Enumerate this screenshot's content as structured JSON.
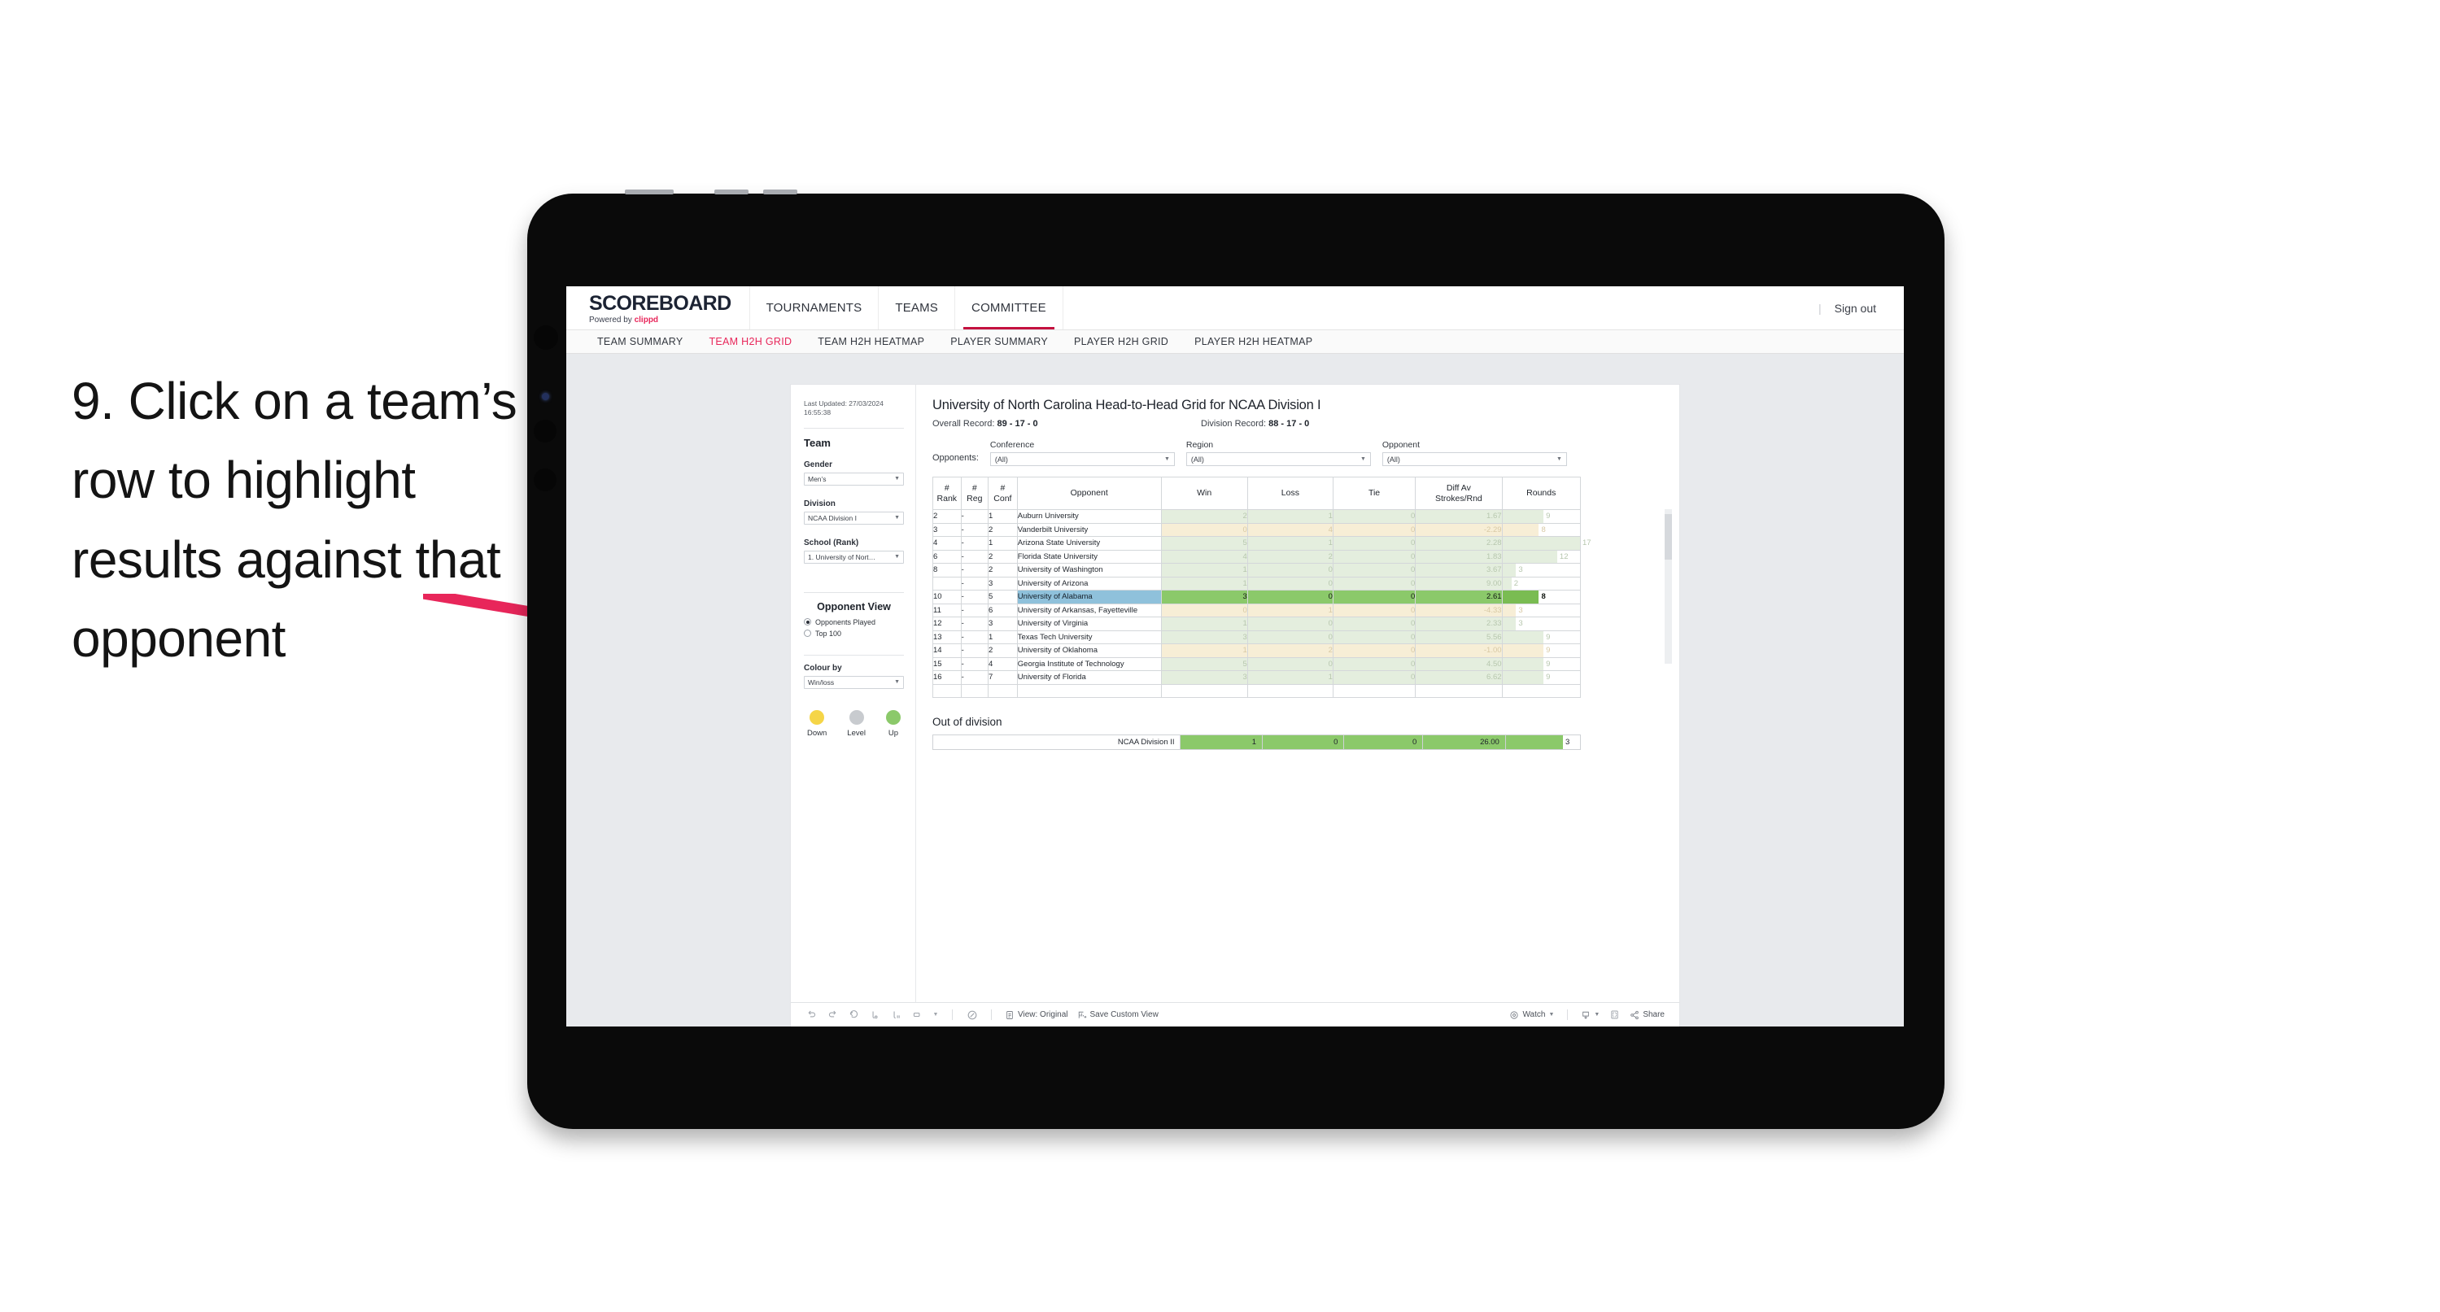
{
  "annotation": {
    "text": "9. Click on a team’s row to highlight results against that opponent",
    "arrow_color": "#E8265A"
  },
  "header": {
    "logo_main": "SCOREBOARD",
    "logo_sub_prefix": "Powered by ",
    "logo_brand": "clippd",
    "nav": [
      {
        "label": "TOURNAMENTS",
        "active": false
      },
      {
        "label": "TEAMS",
        "active": false
      },
      {
        "label": "COMMITTEE",
        "active": true
      }
    ],
    "divider": "|",
    "sign_out": "Sign out"
  },
  "subnav": {
    "items": [
      {
        "label": "TEAM SUMMARY",
        "active": false
      },
      {
        "label": "TEAM H2H GRID",
        "active": true
      },
      {
        "label": "TEAM H2H HEATMAP",
        "active": false
      },
      {
        "label": "PLAYER SUMMARY",
        "active": false
      },
      {
        "label": "PLAYER H2H GRID",
        "active": false
      },
      {
        "label": "PLAYER H2H HEATMAP",
        "active": false
      }
    ]
  },
  "sidebar": {
    "last_updated": "Last Updated: 27/03/2024 16:55:38",
    "team_title": "Team",
    "gender_label": "Gender",
    "gender_value": "Men’s",
    "division_label": "Division",
    "division_value": "NCAA Division I",
    "school_label": "School (Rank)",
    "school_value": "1. University of Nort…",
    "opponent_view_title": "Opponent View",
    "opponent_options": [
      {
        "label": "Opponents Played",
        "selected": true
      },
      {
        "label": "Top 100",
        "selected": false
      }
    ],
    "colour_by_label": "Colour by",
    "colour_by_value": "Win/loss",
    "legend": [
      {
        "label": "Down",
        "color": "#F5D547"
      },
      {
        "label": "Level",
        "color": "#C8CBCF"
      },
      {
        "label": "Up",
        "color": "#8BC96A"
      }
    ]
  },
  "main": {
    "title": "University of North Carolina Head-to-Head Grid for NCAA Division I",
    "overall_record_label": "Overall Record: ",
    "overall_record_value": "89 - 17 - 0",
    "division_record_label": "Division Record: ",
    "division_record_value": "88 - 17 - 0",
    "filters_lead": "Opponents:",
    "filters": [
      {
        "label": "Conference",
        "value": "(All)"
      },
      {
        "label": "Region",
        "value": "(All)"
      },
      {
        "label": "Opponent",
        "value": "(All)"
      }
    ],
    "columns": [
      "# Rank",
      "# Reg",
      "# Conf",
      "Opponent",
      "Win",
      "Loss",
      "Tie",
      "Diff Av Strokes/Rnd",
      "Rounds"
    ],
    "rows": [
      {
        "rank": "2",
        "reg": "-",
        "conf": "1",
        "opponent": "Auburn University",
        "win": "2",
        "loss": "1",
        "tie": "0",
        "diff": "1.67",
        "rounds": "9",
        "tone": "up",
        "selected": false
      },
      {
        "rank": "3",
        "reg": "-",
        "conf": "2",
        "opponent": "Vanderbilt University",
        "win": "0",
        "loss": "4",
        "tie": "0",
        "diff": "-2.29",
        "rounds": "8",
        "tone": "down",
        "selected": false
      },
      {
        "rank": "4",
        "reg": "-",
        "conf": "1",
        "opponent": "Arizona State University",
        "win": "5",
        "loss": "1",
        "tie": "0",
        "diff": "2.28",
        "rounds": "17",
        "tone": "up",
        "selected": false
      },
      {
        "rank": "6",
        "reg": "-",
        "conf": "2",
        "opponent": "Florida State University",
        "win": "4",
        "loss": "2",
        "tie": "0",
        "diff": "1.83",
        "rounds": "12",
        "tone": "up",
        "selected": false
      },
      {
        "rank": "8",
        "reg": "-",
        "conf": "2",
        "opponent": "University of Washington",
        "win": "1",
        "loss": "0",
        "tie": "0",
        "diff": "3.67",
        "rounds": "3",
        "tone": "up",
        "selected": false
      },
      {
        "rank": "",
        "reg": "-",
        "conf": "3",
        "opponent": "University of Arizona",
        "win": "1",
        "loss": "0",
        "tie": "0",
        "diff": "9.00",
        "rounds": "2",
        "tone": "up",
        "selected": false
      },
      {
        "rank": "10",
        "reg": "-",
        "conf": "5",
        "opponent": "University of Alabama",
        "win": "3",
        "loss": "0",
        "tie": "0",
        "diff": "2.61",
        "rounds": "8",
        "tone": "up",
        "selected": true
      },
      {
        "rank": "11",
        "reg": "-",
        "conf": "6",
        "opponent": "University of Arkansas, Fayetteville",
        "win": "0",
        "loss": "1",
        "tie": "0",
        "diff": "-4.33",
        "rounds": "3",
        "tone": "down",
        "selected": false
      },
      {
        "rank": "12",
        "reg": "-",
        "conf": "3",
        "opponent": "University of Virginia",
        "win": "1",
        "loss": "0",
        "tie": "0",
        "diff": "2.33",
        "rounds": "3",
        "tone": "up",
        "selected": false
      },
      {
        "rank": "13",
        "reg": "-",
        "conf": "1",
        "opponent": "Texas Tech University",
        "win": "3",
        "loss": "0",
        "tie": "0",
        "diff": "5.56",
        "rounds": "9",
        "tone": "up",
        "selected": false
      },
      {
        "rank": "14",
        "reg": "-",
        "conf": "2",
        "opponent": "University of Oklahoma",
        "win": "1",
        "loss": "2",
        "tie": "0",
        "diff": "-1.00",
        "rounds": "9",
        "tone": "down",
        "selected": false
      },
      {
        "rank": "15",
        "reg": "-",
        "conf": "4",
        "opponent": "Georgia Institute of Technology",
        "win": "5",
        "loss": "0",
        "tie": "0",
        "diff": "4.50",
        "rounds": "9",
        "tone": "up",
        "selected": false
      },
      {
        "rank": "16",
        "reg": "-",
        "conf": "7",
        "opponent": "University of Florida",
        "win": "3",
        "loss": "1",
        "tie": "0",
        "diff": "6.62",
        "rounds": "9",
        "tone": "up",
        "selected": false
      }
    ],
    "out_of_division_title": "Out of division",
    "out_of_division_row": {
      "label": "NCAA Division II",
      "win": "1",
      "loss": "0",
      "tie": "0",
      "diff": "26.00",
      "rounds": "3"
    }
  },
  "toolbar": {
    "icons": [
      "undo-icon",
      "redo-icon",
      "revert-icon",
      "refresh-icon",
      "pause-icon",
      "swap-icon",
      "dropdown-caret-icon",
      "clear-icon"
    ],
    "view_label": "View: Original",
    "save_label": "Save Custom View",
    "watch_label": "Watch",
    "share_label": "Share",
    "download_icon": "download-icon",
    "fullscreen_icon": "fullscreen-icon"
  },
  "chart_data": {
    "type": "table",
    "title": "University of North Carolina Head-to-Head Grid for NCAA Division I",
    "categories": [
      "Auburn University",
      "Vanderbilt University",
      "Arizona State University",
      "Florida State University",
      "University of Washington",
      "University of Arizona",
      "University of Alabama",
      "University of Arkansas, Fayetteville",
      "University of Virginia",
      "Texas Tech University",
      "University of Oklahoma",
      "Georgia Institute of Technology",
      "University of Florida"
    ],
    "series": [
      {
        "name": "Win",
        "values": [
          2,
          0,
          5,
          4,
          1,
          1,
          3,
          0,
          1,
          3,
          1,
          5,
          3
        ]
      },
      {
        "name": "Loss",
        "values": [
          1,
          4,
          1,
          2,
          0,
          0,
          0,
          1,
          0,
          0,
          2,
          0,
          1
        ]
      },
      {
        "name": "Tie",
        "values": [
          0,
          0,
          0,
          0,
          0,
          0,
          0,
          0,
          0,
          0,
          0,
          0,
          0
        ]
      },
      {
        "name": "Diff Av Strokes/Rnd",
        "values": [
          1.67,
          -2.29,
          2.28,
          1.83,
          3.67,
          9.0,
          2.61,
          -4.33,
          2.33,
          5.56,
          -1.0,
          4.5,
          6.62
        ]
      },
      {
        "name": "Rounds",
        "values": [
          9,
          8,
          17,
          12,
          3,
          2,
          8,
          3,
          3,
          9,
          9,
          9,
          9
        ]
      }
    ],
    "colors": {
      "up": "#e4eede",
      "down": "#f7eed6",
      "selected_green": "#8BC96A",
      "selected_blue": "#8FC1DB"
    },
    "legend_position": "sidebar",
    "notes": "Rounds column rendered as in-cell horizontal bars, max 17."
  }
}
